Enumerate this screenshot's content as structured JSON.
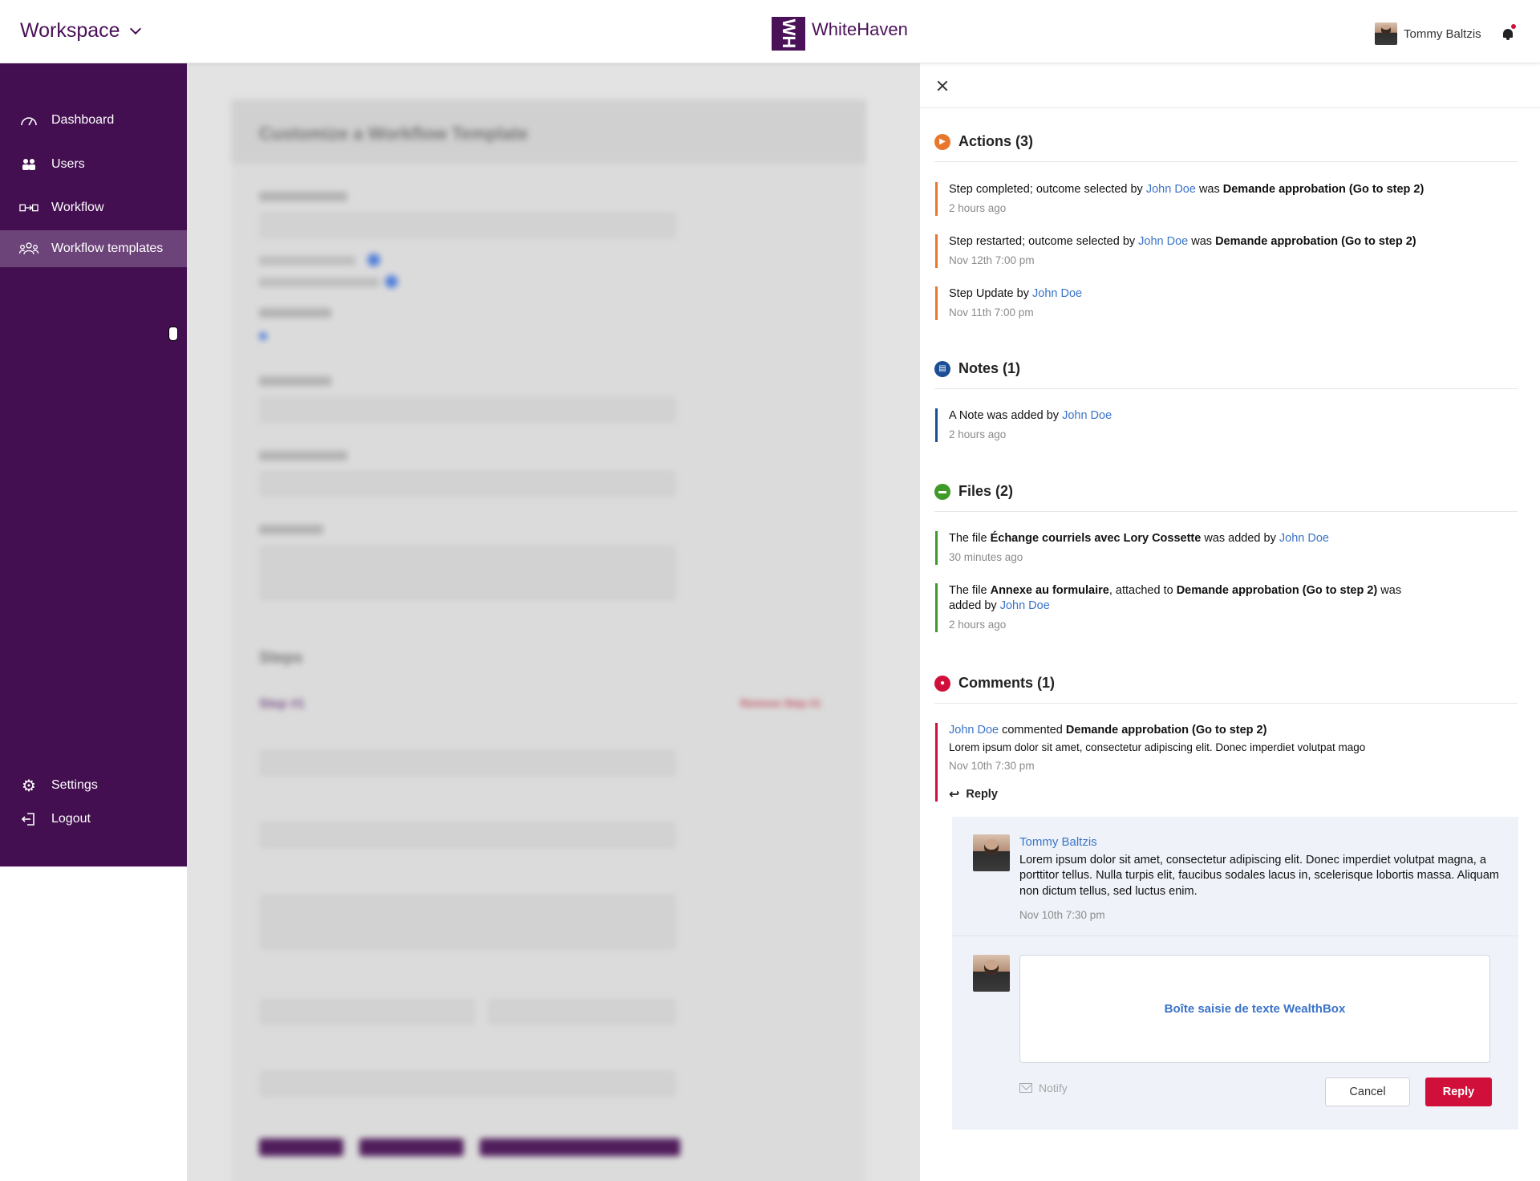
{
  "header": {
    "workspace_label": "Workspace",
    "logo_mark": "WH",
    "logo_text": "WhiteHaven",
    "user_name": "Tommy Baltzis"
  },
  "sidebar": {
    "items": [
      {
        "label": "Dashboard",
        "icon": "gauge-icon"
      },
      {
        "label": "Users",
        "icon": "users-icon"
      },
      {
        "label": "Workflow",
        "icon": "workflow-icon"
      },
      {
        "label": "Workflow templates",
        "icon": "group-icon",
        "active": true
      }
    ],
    "bottom": [
      {
        "label": "Settings",
        "icon": "gear-icon"
      },
      {
        "label": "Logout",
        "icon": "logout-icon"
      }
    ]
  },
  "background_form": {
    "title": "Customize a Workflow Template",
    "steps_heading": "Steps",
    "step_label": "Step #1",
    "remove_step": "Remove Step #1"
  },
  "panel": {
    "actions": {
      "title": "Actions (3)",
      "color": "#e8772e",
      "entries": [
        {
          "prefix": "Step completed; outcome selected by ",
          "user": "John Doe",
          "mid": " was ",
          "bold": "Demande approbation (Go to step 2)",
          "time": "2 hours ago"
        },
        {
          "prefix": "Step restarted; outcome selected by ",
          "user": "John Doe",
          "mid": " was ",
          "bold": "Demande approbation (Go to step 2)",
          "time": "Nov 12th 7:00 pm"
        },
        {
          "prefix": "Step Update by ",
          "user": "John Doe",
          "time": "Nov 11th 7:00 pm"
        }
      ]
    },
    "notes": {
      "title": "Notes (1)",
      "color": "#1b4e96",
      "entries": [
        {
          "prefix": "A Note was added by ",
          "user": "John Doe",
          "time": "2 hours ago"
        }
      ]
    },
    "files": {
      "title": "Files (2)",
      "color": "#3f9b27",
      "entries": [
        {
          "prefix": "The file ",
          "bold": "Échange courriels avec Lory Cossette",
          "mid": " was added by ",
          "user": "John Doe",
          "time": "30 minutes ago"
        },
        {
          "prefix": "The file ",
          "bold": "Annexe au formulaire",
          "mid": ", attached to ",
          "bold2": "Demande approbation (Go to step 2)",
          "suffix": " was",
          "line2_prefix": "added by ",
          "user": "John Doe",
          "time": "2 hours ago"
        }
      ]
    },
    "comments": {
      "title": "Comments (1)",
      "color": "#d0103a",
      "entry": {
        "user": "John Doe",
        "mid": " commented ",
        "bold": "Demande approbation (Go to step 2)",
        "text": "Lorem ipsum dolor sit amet, consectetur adipiscing elit. Donec imperdiet volutpat mago",
        "time": "Nov 10th 7:30 pm",
        "reply_label": "Reply"
      },
      "reply": {
        "user": "Tommy Baltzis",
        "text": "Lorem ipsum dolor sit amet, consectetur adipiscing elit. Donec imperdiet volutpat magna, a porttitor tellus. Nulla turpis elit, faucibus sodales lacus in, scelerisque lobortis massa. Aliquam non dictum tellus, sed luctus enim.",
        "time": "Nov 10th 7:30 pm"
      },
      "compose": {
        "placeholder": "Boîte saisie de texte WealthBox",
        "notify_label": "Notify",
        "cancel_label": "Cancel",
        "reply_label": "Reply"
      }
    }
  }
}
